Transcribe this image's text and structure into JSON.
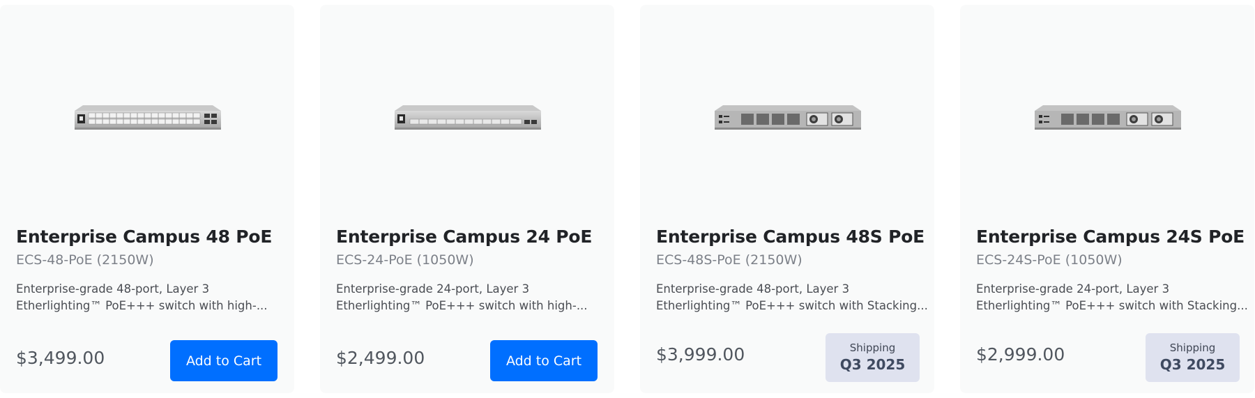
{
  "products": [
    {
      "title": "Enterprise Campus 48 PoE",
      "sku": "ECS-48-PoE (2150W)",
      "desc_line1": "Enterprise-grade 48-port, Layer 3",
      "desc_line2": "Etherlighting™ PoE+++ switch with high-...",
      "price": "$3,499.00",
      "action": "Add to Cart",
      "image_icon": "switch-front-48-port-icon"
    },
    {
      "title": "Enterprise Campus 24 PoE",
      "sku": "ECS-24-PoE (1050W)",
      "desc_line1": "Enterprise-grade 24-port, Layer 3",
      "desc_line2": "Etherlighting™ PoE+++ switch with high-...",
      "price": "$2,499.00",
      "action": "Add to Cart",
      "image_icon": "switch-front-24-port-icon"
    },
    {
      "title": "Enterprise Campus 48S PoE",
      "sku": "ECS-48S-PoE (2150W)",
      "desc_line1": "Enterprise-grade 48-port, Layer 3",
      "desc_line2": "Etherlighting™ PoE+++ switch with Stacking...",
      "price": "$3,999.00",
      "shipping_label": "Shipping",
      "shipping_date": "Q3 2025",
      "image_icon": "switch-rear-fans-icon"
    },
    {
      "title": "Enterprise Campus 24S PoE",
      "sku": "ECS-24S-PoE (1050W)",
      "desc_line1": "Enterprise-grade 24-port, Layer 3",
      "desc_line2": "Etherlighting™ PoE+++ switch with Stacking...",
      "price": "$2,999.00",
      "shipping_label": "Shipping",
      "shipping_date": "Q3 2025",
      "image_icon": "switch-rear-fans-icon"
    }
  ],
  "colors": {
    "card_bg": "#f9fafa",
    "title": "#212327",
    "sku": "#7c8088",
    "price": "#50565e",
    "accent": "#006fff",
    "shipping_badge_bg": "#dfe2ef"
  }
}
